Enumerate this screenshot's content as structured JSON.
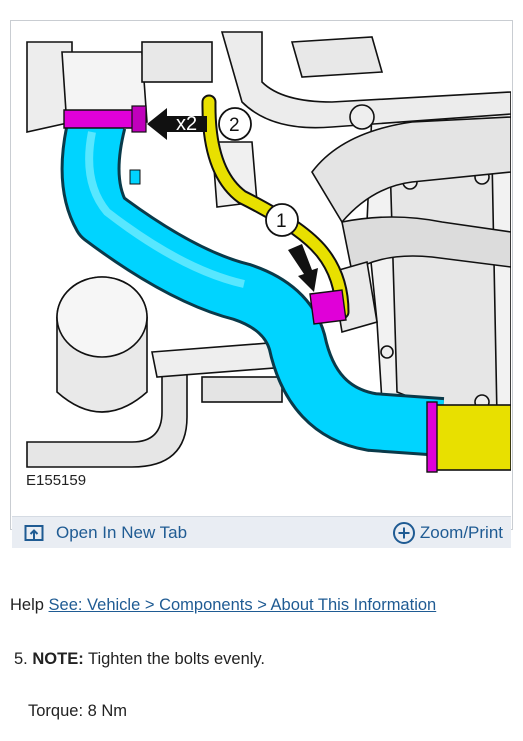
{
  "figure": {
    "id_label": "E155159",
    "callout_x2": "x2",
    "callout_1": "1",
    "callout_2": "2",
    "open_tab_label": "Open In New Tab",
    "zoom_print_label": "Zoom/Print",
    "colors": {
      "hose_cyan": "#00d4ff",
      "hose_yellow": "#e8e000",
      "clamp_magenta": "#e000d8",
      "link_blue": "#1f5b93",
      "toolbar_bg": "#e9edf3"
    }
  },
  "help": {
    "prefix": "Help",
    "link_text": "See: Vehicle > Components > About This Information"
  },
  "step": {
    "number": "5.",
    "note_label": "NOTE:",
    "note_text": "Tighten the bolts evenly."
  },
  "torque": {
    "text": "Torque: 8 Nm"
  }
}
